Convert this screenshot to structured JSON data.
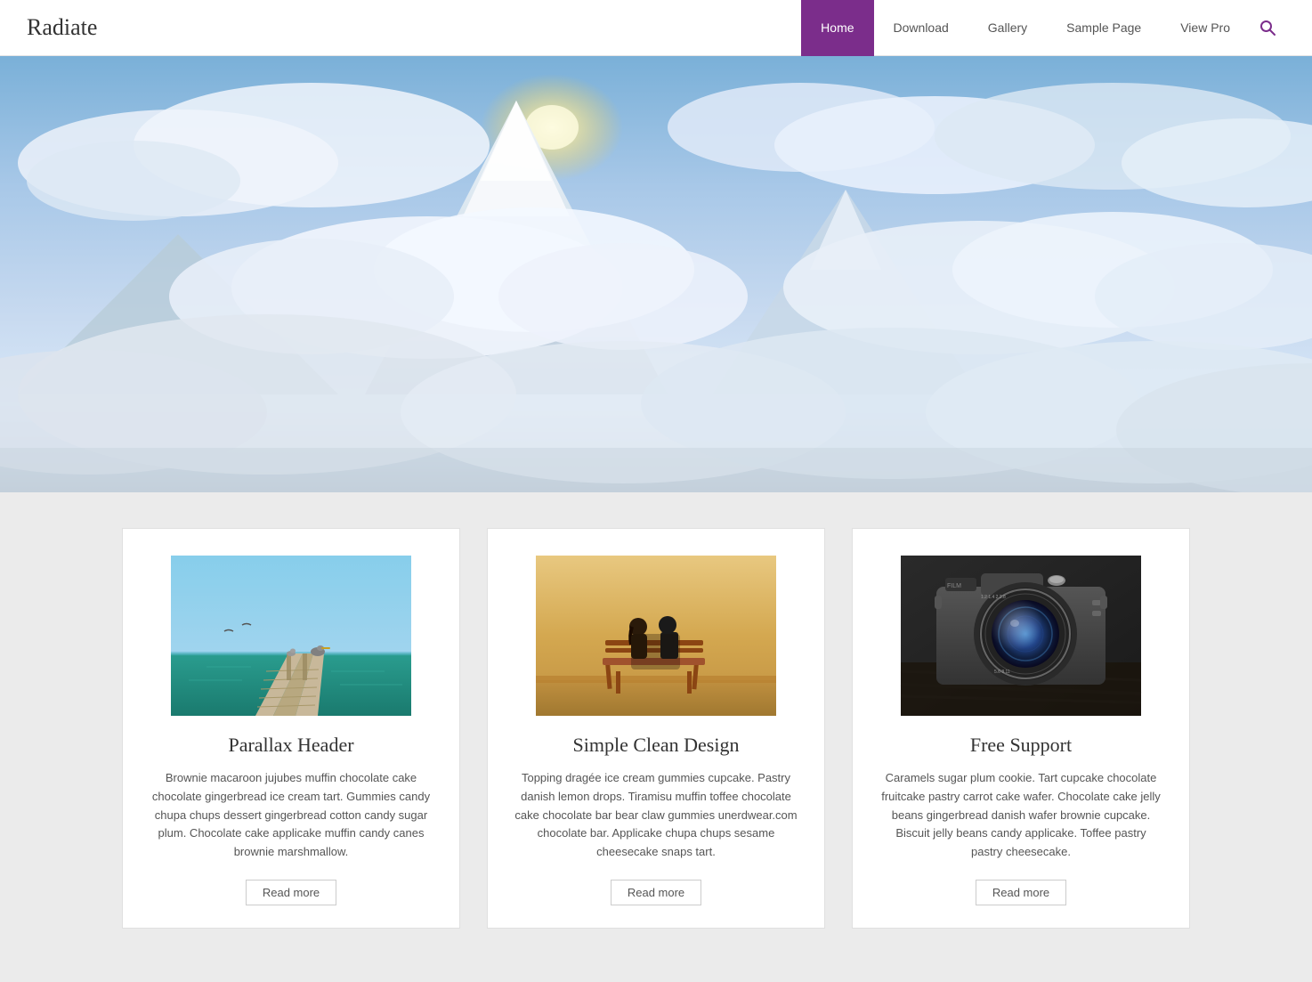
{
  "site": {
    "title": "Radiate"
  },
  "nav": {
    "items": [
      {
        "label": "Home",
        "active": true
      },
      {
        "label": "Download",
        "active": false
      },
      {
        "label": "Gallery",
        "active": false
      },
      {
        "label": "Sample Page",
        "active": false
      },
      {
        "label": "View Pro",
        "active": false
      }
    ]
  },
  "hero": {
    "alt": "Mountain landscape with clouds"
  },
  "cards": [
    {
      "title": "Parallax Header",
      "body": "Brownie macaroon jujubes muffin chocolate cake chocolate gingerbread ice cream tart. Gummies candy chupa chups dessert gingerbread cotton candy sugar plum. Chocolate cake applicake muffin candy canes brownie marshmallow.",
      "read_more": "Read more"
    },
    {
      "title": "Simple Clean Design",
      "body": "Topping dragée ice cream gummies cupcake. Pastry danish lemon drops. Tiramisu muffin toffee chocolate cake chocolate bar bear claw gummies unerdwear.com chocolate bar. Applicake chupa chups sesame cheesecake snaps tart.",
      "read_more": "Read more"
    },
    {
      "title": "Free Support",
      "body": "Caramels sugar plum cookie. Tart cupcake chocolate fruitcake pastry carrot cake wafer. Chocolate cake jelly beans gingerbread danish wafer brownie cupcake. Biscuit jelly beans candy applicake. Toffee pastry pastry cheesecake.",
      "read_more": "Read more"
    }
  ],
  "colors": {
    "accent": "#7b2d8b",
    "nav_active_bg": "#7b2d8b",
    "nav_active_text": "#ffffff"
  }
}
